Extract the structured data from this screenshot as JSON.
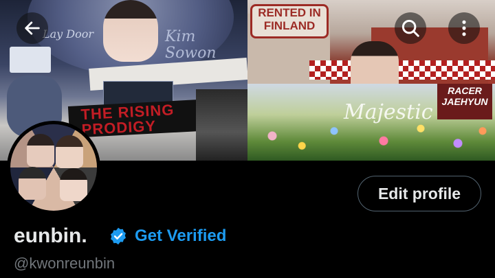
{
  "header": {
    "back_icon": "arrow-left-icon",
    "search_icon": "search-icon",
    "more_icon": "more-vertical-icon"
  },
  "banner": {
    "left": {
      "title": "THE RISING PRODIGY",
      "script_top": "Lay Door",
      "script_right": "Kim Sowon"
    },
    "right_top": {
      "sign": "RENTED IN FINLAND"
    },
    "right_bottom": {
      "script": "Majestic",
      "tag": "RACER JAEHYUN"
    }
  },
  "profile": {
    "display_name": "eunbin.",
    "handle": "@kwonreunbin",
    "get_verified_label": "Get Verified",
    "edit_profile_label": "Edit profile"
  },
  "colors": {
    "background": "#000000",
    "primary_text": "#e7e9ea",
    "secondary_text": "#71767b",
    "accent": "#1d9bf0",
    "button_border": "#536471"
  }
}
